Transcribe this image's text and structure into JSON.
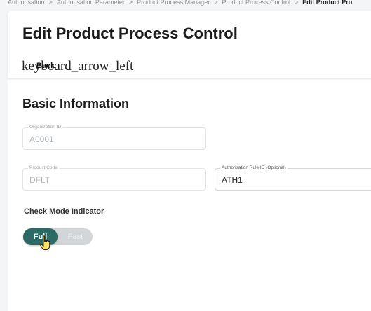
{
  "breadcrumb": {
    "items": [
      "Authorisation",
      "Authorisation Parameter",
      "Product Process Manager",
      "Product Process Control",
      "Edit Product Pro"
    ],
    "separator": ">"
  },
  "header": {
    "title": "Edit Product Process Control",
    "back_icon_text": "keyboard_arrow_left",
    "back_label": "Back"
  },
  "basic_info": {
    "title": "Basic Information",
    "organization_id": {
      "label": "Organization ID",
      "value": "A0001"
    },
    "product_code": {
      "label": "Product Code",
      "value": "DFLT"
    },
    "authorisation_rule_id": {
      "label": "Authorisation Rule ID (Optional)",
      "value": "ATH1"
    }
  },
  "check_mode": {
    "label": "Check Mode Indicator",
    "options": [
      "Full",
      "Fast"
    ],
    "selected": "Full"
  },
  "colors": {
    "accent": "#2b6a65",
    "toggle_track": "#d3d6d8",
    "muted_text": "#b3b8bd"
  }
}
